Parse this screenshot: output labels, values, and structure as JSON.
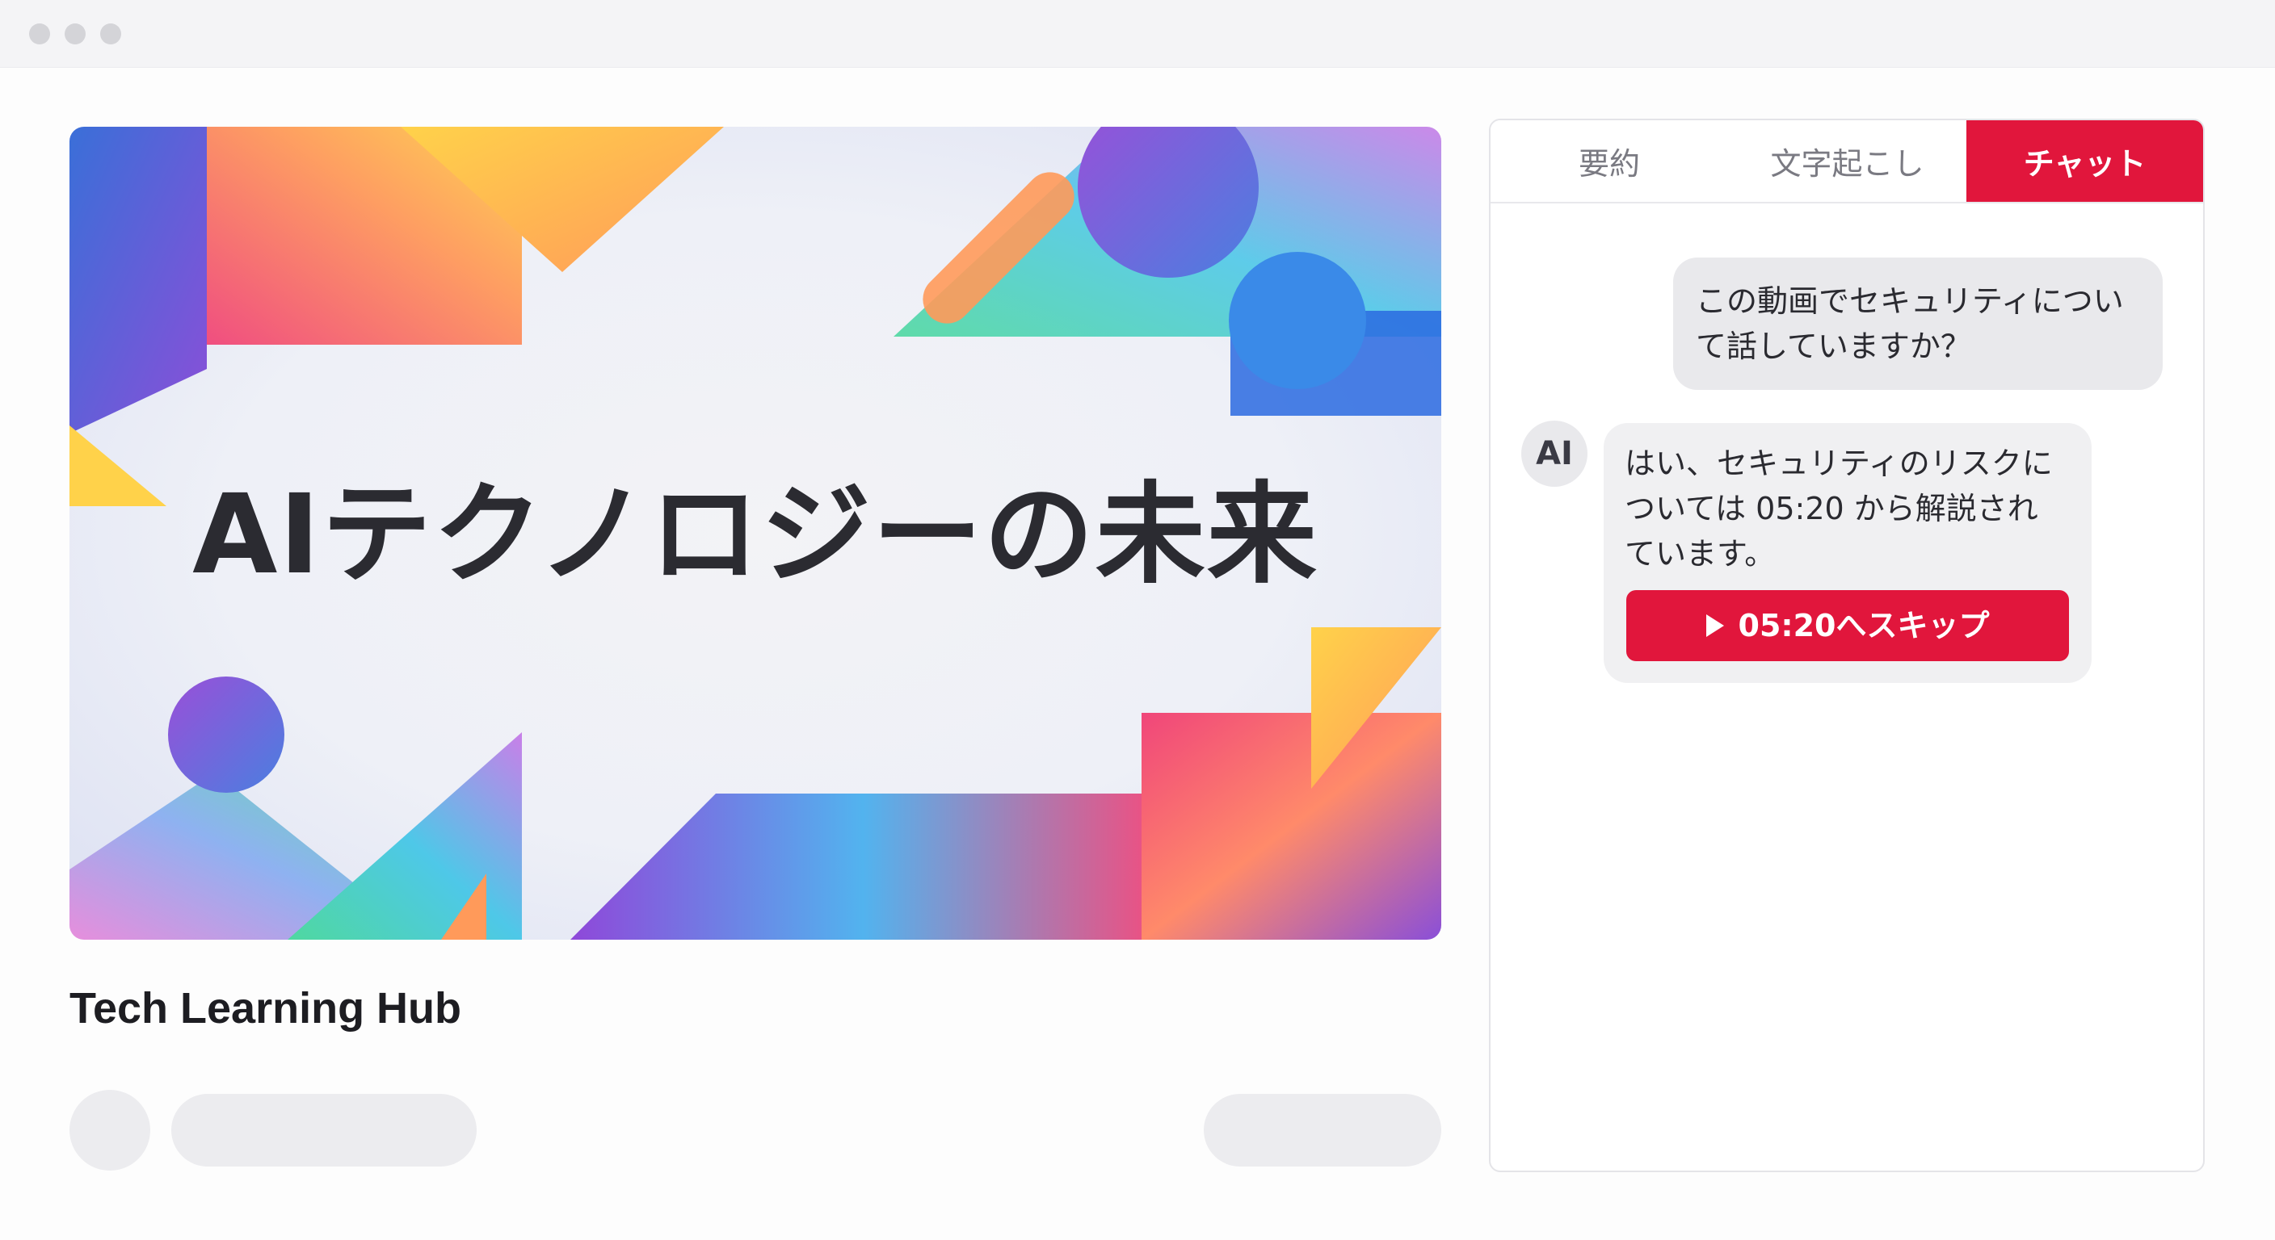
{
  "window": {
    "controls": [
      "window-dot",
      "window-dot",
      "window-dot"
    ]
  },
  "video": {
    "title": "AIテクノロジーの未来",
    "palette": {
      "magenta": "#f0467a",
      "purple": "#8a4fd8",
      "blue": "#4a7fe0",
      "cyan": "#4ec8e8",
      "green": "#4fd8a0",
      "yellow": "#ffd24a",
      "orange": "#ff9a5a"
    }
  },
  "channel": {
    "name": "Tech Learning Hub"
  },
  "panel": {
    "tabs": [
      {
        "label": "要約",
        "active": false
      },
      {
        "label": "文字起こし",
        "active": false
      },
      {
        "label": "チャット",
        "active": true
      }
    ],
    "chat": {
      "user_message_lines": [
        "この動画でセキュリティについ",
        "て話していますか？"
      ],
      "ai_avatar_label": "AI",
      "ai_message_lines": [
        "はい、セキュリティのリスクに",
        "ついては 05:20 から解説され",
        "ています。"
      ],
      "skip_button_label": "05:20へスキップ"
    }
  },
  "colors": {
    "accent": "#e1163c",
    "bubble": "#e9e9ec",
    "placeholder": "#ececef"
  }
}
